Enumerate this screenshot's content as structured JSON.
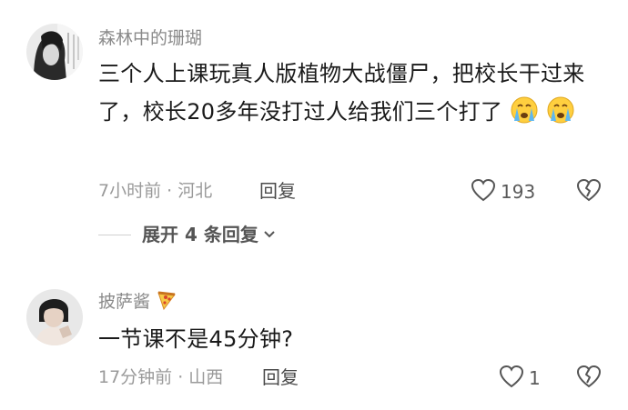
{
  "comments": [
    {
      "username": "森林中的珊瑚",
      "text": "三个人上课玩真人版植物大战僵尸，把校长干过来了，校长20多年没打过人给我们三个打了",
      "emoji": "crying-face-emoji",
      "time_location": "7小时前 · 河北",
      "reply_label": "回复",
      "like_count": "193",
      "expand_label": "展开 4 条回复"
    },
    {
      "username": "披萨酱",
      "username_emoji": "pizza-emoji",
      "text": "一节课不是45分钟?",
      "time_location": "17分钟前 · 山西",
      "reply_label": "回复",
      "like_count": "1"
    }
  ],
  "colors": {
    "meta_gray": "#9a9a9a",
    "text": "#1a1a1a"
  }
}
